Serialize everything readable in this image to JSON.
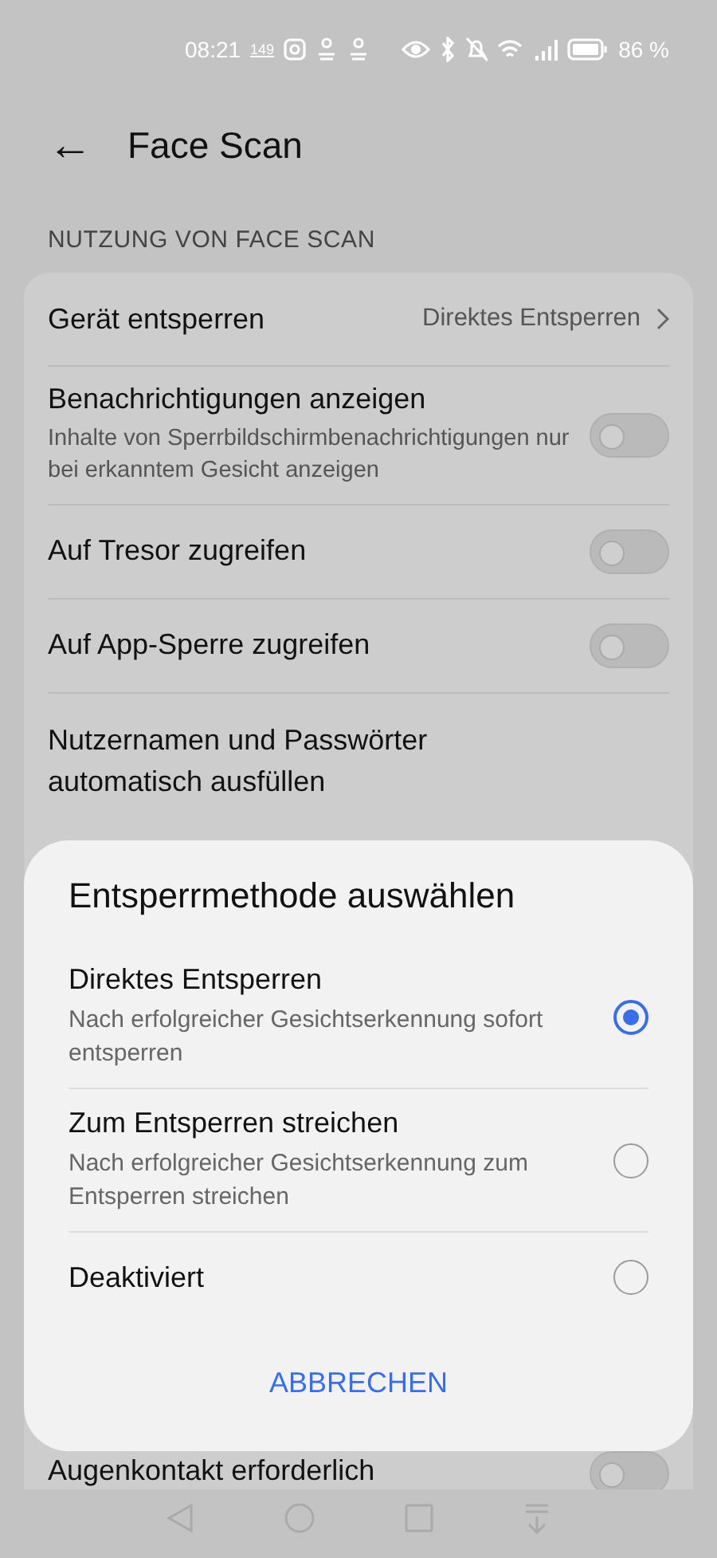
{
  "status_bar": {
    "time": "08:21",
    "badge": "149",
    "battery_text": "86 %"
  },
  "header": {
    "back": "←",
    "title": "Face Scan"
  },
  "section_title": "NUTZUNG VON FACE SCAN",
  "settings": [
    {
      "kind": "link",
      "label": "Gerät entsperren",
      "value": "Direktes Entsperren"
    },
    {
      "kind": "toggle",
      "label": "Benachrichtigungen anzeigen",
      "description": "Inhalte von Sperrbildschirmbenachrichtigungen nur bei erkanntem Gesicht anzeigen",
      "on": false
    },
    {
      "kind": "toggle",
      "label": "Auf Tresor zugreifen",
      "on": false
    },
    {
      "kind": "toggle",
      "label": "Auf App-Sperre zugreifen",
      "on": false
    },
    {
      "kind": "partial",
      "label": "Nutzernamen und Passwörter automatisch ausfüllen"
    }
  ],
  "last_setting": {
    "label": "Augenkontakt erforderlich",
    "on": false
  },
  "dialog": {
    "title": "Entsperrmethode auswählen",
    "options": [
      {
        "label": "Direktes Entsperren",
        "description": "Nach erfolgreicher Gesichtserkennung sofort entsperren",
        "selected": true
      },
      {
        "label": "Zum Entsperren streichen",
        "description": "Nach erfolgreicher Gesichtserkennung zum Entsperren streichen",
        "selected": false
      },
      {
        "label": "Deaktiviert",
        "selected": false
      }
    ],
    "cancel": "ABBRECHEN"
  }
}
